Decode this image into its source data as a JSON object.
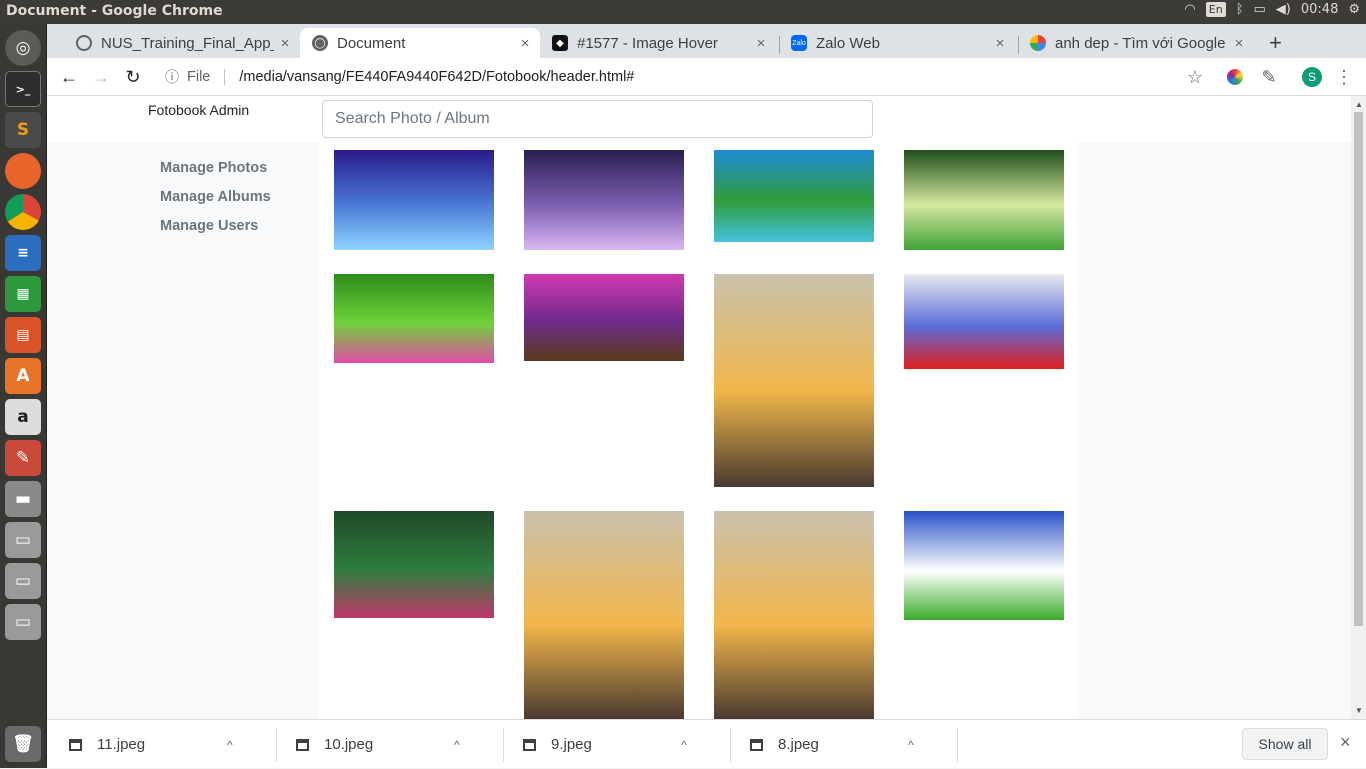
{
  "os": {
    "window_title": "Document - Google Chrome",
    "keyboard": "En",
    "clock": "00:48"
  },
  "tabs": [
    {
      "label": "NUS_Training_Final_App_",
      "close": "×",
      "active": false,
      "icon": "loading-icon"
    },
    {
      "label": "Document",
      "close": "×",
      "active": true,
      "icon": "globe-icon"
    },
    {
      "label": "#1577 - Image Hover",
      "close": "×",
      "active": false,
      "icon": "codepen-icon"
    },
    {
      "label": "Zalo Web",
      "close": "×",
      "active": false,
      "icon": "zalo-icon"
    },
    {
      "label": "anh dep - Tìm với Google",
      "close": "×",
      "active": false,
      "icon": "google-icon"
    }
  ],
  "new_tab": "+",
  "toolbar": {
    "file_label": "File",
    "url": "/media/vansang/FE440FA9440F642D/Fotobook/header.html#",
    "profile_initial": "S"
  },
  "page": {
    "brand": "Fotobook Admin",
    "search_placeholder": "Search Photo / Album",
    "nav": [
      "Manage Photos",
      "Manage Albums",
      "Manage Users"
    ],
    "photos": [
      {
        "name": "fishbowl-photo",
        "colors": [
          "#2a1a8a",
          "#4a7bd6",
          "#8fd3ff"
        ]
      },
      {
        "name": "purple-tree-street-photo",
        "colors": [
          "#2a1f4f",
          "#7d5fb2",
          "#d8b6f0"
        ]
      },
      {
        "name": "river-cottage-photo",
        "colors": [
          "#1f8ad6",
          "#2f9d3a",
          "#44c1e0"
        ]
      },
      {
        "name": "tree-meadow-sunset-photo",
        "colors": [
          "#1f4f1a",
          "#d6e8a0",
          "#3fa036"
        ]
      },
      {
        "name": "pink-flower-photo",
        "colors": [
          "#2d8c1a",
          "#6fd13a",
          "#e24aa8"
        ]
      },
      {
        "name": "lavender-field-tree-photo",
        "colors": [
          "#d03ab0",
          "#6e2a8c",
          "#5a3a1a"
        ]
      },
      {
        "name": "man-on-branch-photo",
        "colors": [
          "#c9c1ae",
          "#f1b64a",
          "#4a3a32"
        ]
      },
      {
        "name": "blue-red-hearts-photo",
        "colors": [
          "#e8e8ef",
          "#5b6cd8",
          "#e21f1f"
        ]
      },
      {
        "name": "lotus-boat-photo",
        "colors": [
          "#1f4a2a",
          "#2e7d3e",
          "#c2386a"
        ]
      },
      {
        "name": "man-on-branch-photo-2",
        "colors": [
          "#c9c1ae",
          "#f1b64a",
          "#4a3a32"
        ]
      },
      {
        "name": "man-on-branch-photo-3",
        "colors": [
          "#c9c1ae",
          "#f1b64a",
          "#4a3a32"
        ]
      },
      {
        "name": "sunflower-sky-photo",
        "colors": [
          "#2a52c8",
          "#ffffff",
          "#3aaa2a"
        ]
      }
    ]
  },
  "downloads": {
    "items": [
      "11.jpeg",
      "10.jpeg",
      "9.jpeg",
      "8.jpeg"
    ],
    "show_all": "Show all",
    "close": "×",
    "chevron": "^"
  },
  "colors": {
    "launcher_bg": "#3a3834",
    "topbar_bg": "#3c3b37",
    "tab_strip": "#dee1e6",
    "sidebar_bg": "#f8f9fa",
    "link_gray": "#6c757d"
  }
}
